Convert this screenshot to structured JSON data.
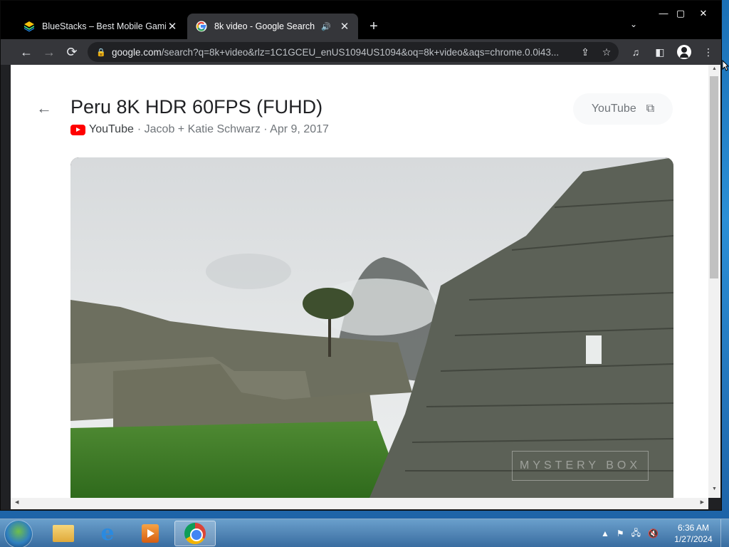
{
  "tabs": [
    {
      "title": "BlueStacks – Best Mobile Gaming",
      "favicon": "bluestacks-icon",
      "active": false
    },
    {
      "title": "8k video - Google Search",
      "favicon": "google-icon",
      "active": true,
      "audio": true
    }
  ],
  "toolbar": {
    "url_host": "google.com",
    "url_path": "/search?q=8k+video&rlz=1C1GCEU_enUS1094US1094&oq=8k+video&aqs=chrome.0.0i43..."
  },
  "video": {
    "title": "Peru 8K HDR 60FPS (FUHD)",
    "source": "YouTube",
    "meta": "· Jacob + Katie Schwarz · Apr 9, 2017",
    "chip_label": "YouTube",
    "watermark": "MYSTERY BOX"
  },
  "taskbar": {
    "time": "6:36 AM",
    "date": "1/27/2024"
  },
  "colors": {
    "chrome_bg": "#202124",
    "youtube_red": "#ff0000",
    "taskbar": "#3c6ea0"
  }
}
